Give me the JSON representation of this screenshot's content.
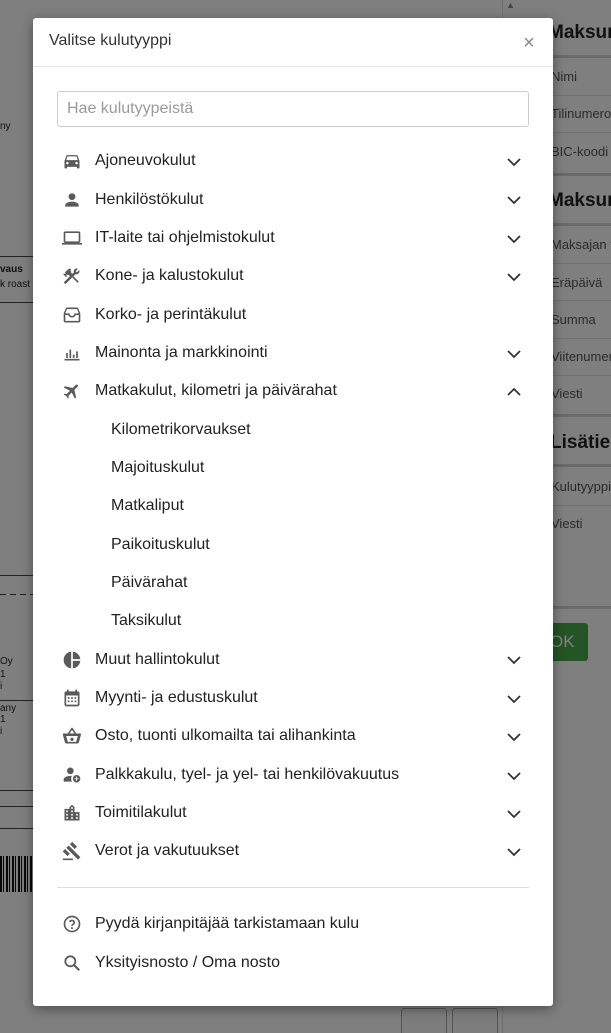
{
  "background": {
    "left_texts": [
      "ny",
      "vaus",
      "k roast c",
      "Oy",
      "1",
      "i",
      "any",
      "1",
      "i"
    ],
    "sections": [
      "Maksun",
      "Maksun",
      "Lisätiedot"
    ],
    "fields_a": [
      "Nimi",
      "Tilinumero",
      "BIC-koodi"
    ],
    "fields_b": [
      "Maksajan t",
      "Eräpäivä",
      "Summa",
      "Viitenumer",
      "Viesti"
    ],
    "fields_c": [
      "Kulutyyppi",
      "Viesti"
    ],
    "ok_label": "OK"
  },
  "modal": {
    "title": "Valitse kulutyyppi",
    "close_label": "×",
    "search_placeholder": "Hae kulutyypeistä",
    "categories": [
      {
        "label": "Ajoneuvokulut",
        "icon": "car-icon",
        "expandable": true
      },
      {
        "label": "Henkilöstökulut",
        "icon": "person-icon",
        "expandable": true
      },
      {
        "label": "IT-laite tai ohjelmistokulut",
        "icon": "laptop-icon",
        "expandable": true
      },
      {
        "label": "Kone- ja kalustokulut",
        "icon": "tools-icon",
        "expandable": true
      },
      {
        "label": "Korko- ja perintäkulut",
        "icon": "inbox-icon",
        "expandable": false
      },
      {
        "label": "Mainonta ja markkinointi",
        "icon": "bar-chart-icon",
        "expandable": true
      },
      {
        "label": "Matkakulut, kilometri ja päivärahat",
        "icon": "airplane-icon",
        "expandable": true,
        "expanded": true,
        "children": [
          "Kilometrikorvaukset",
          "Majoituskulut",
          "Matkaliput",
          "Paikoituskulut",
          "Päivärahat",
          "Taksikulut"
        ]
      },
      {
        "label": "Muut hallintokulut",
        "icon": "pie-chart-icon",
        "expandable": true
      },
      {
        "label": "Myynti- ja edustuskulut",
        "icon": "calendar-icon",
        "expandable": true
      },
      {
        "label": "Osto, tuonti ulkomailta tai alihankinta",
        "icon": "basket-icon",
        "expandable": true
      },
      {
        "label": "Palkkakulu, tyel- ja yel- tai henkilövakuutus",
        "icon": "person-add-icon",
        "expandable": true
      },
      {
        "label": "Toimitilakulut",
        "icon": "building-icon",
        "expandable": true
      },
      {
        "label": "Verot ja vakutuukset",
        "icon": "gavel-icon",
        "expandable": true
      }
    ],
    "footer_items": [
      {
        "label": "Pyydä kirjanpitäjää tarkistamaan kulu",
        "icon": "help-circle-icon"
      },
      {
        "label": "Yksityisnosto / Oma nosto",
        "icon": "search-icon"
      }
    ]
  }
}
